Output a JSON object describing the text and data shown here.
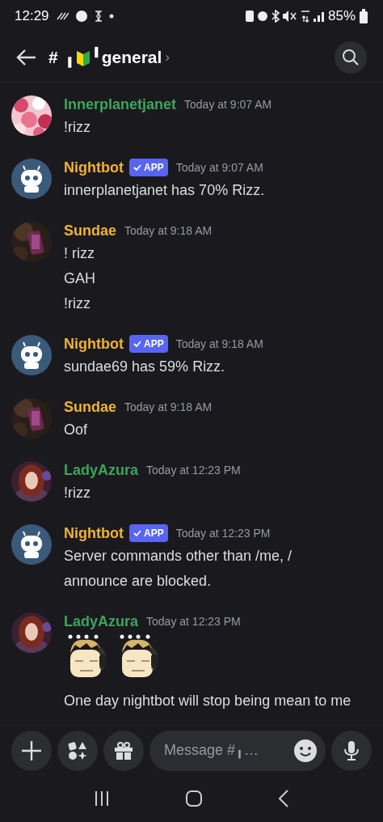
{
  "status_bar": {
    "time": "12:29",
    "battery": "85%"
  },
  "header": {
    "hash": "#",
    "prefix": "╻",
    "name": "╹general",
    "chevron": "›"
  },
  "messages": [
    {
      "author": "Innerplanetjanet",
      "color": "#3ba55c",
      "app": false,
      "time": "Today at 9:07 AM",
      "lines": [
        "!rizz"
      ]
    },
    {
      "author": "Nightbot",
      "color": "#f0b232",
      "app": true,
      "app_label": "APP",
      "time": "Today at 9:07 AM",
      "lines": [
        "innerplanetjanet has 70% Rizz."
      ]
    },
    {
      "author": "Sundae",
      "color": "#f0b232",
      "app": false,
      "time": "Today at 9:18 AM",
      "lines": [
        "! rizz",
        "GAH",
        "!rizz"
      ]
    },
    {
      "author": "Nightbot",
      "color": "#f0b232",
      "app": true,
      "app_label": "APP",
      "time": "Today at 9:18 AM",
      "lines": [
        "sundae69 has 59% Rizz."
      ]
    },
    {
      "author": "Sundae",
      "color": "#f0b232",
      "app": false,
      "time": "Today at 9:18 AM",
      "lines": [
        "Oof"
      ]
    },
    {
      "author": "LadyAzura",
      "color": "#3ba55c",
      "app": false,
      "time": "Today at 12:23 PM",
      "lines": [
        "!rizz"
      ]
    },
    {
      "author": "Nightbot",
      "color": "#f0b232",
      "app": true,
      "app_label": "APP",
      "time": "Today at 12:23 PM",
      "lines": [
        "Server commands other than /me, / announce are blocked."
      ]
    },
    {
      "author": "LadyAzura",
      "color": "#3ba55c",
      "app": false,
      "time": "Today at 12:23 PM",
      "stickers": [
        {
          "kind": "picture"
        },
        {
          "kind": "picture"
        }
      ],
      "lines": [
        "One day nightbot will stop being mean to me"
      ]
    }
  ],
  "composer": {
    "placeholder": "Message #╻…"
  }
}
